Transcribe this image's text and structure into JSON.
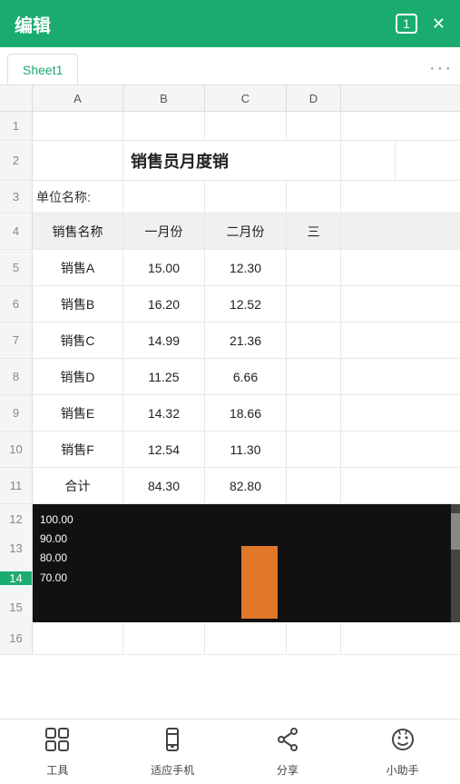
{
  "topBar": {
    "title": "编辑",
    "numLabel": "1",
    "closeIcon": "✕"
  },
  "sheetTab": {
    "label": "Sheet1",
    "moreIcon": "···"
  },
  "colHeaders": [
    "A",
    "B",
    "C",
    "D"
  ],
  "rows": [
    {
      "rowNum": "1",
      "cells": [
        "",
        "",
        "",
        "",
        ""
      ]
    },
    {
      "rowNum": "2",
      "cells": [
        "",
        "",
        "销售员月度销",
        "",
        ""
      ]
    },
    {
      "rowNum": "3",
      "cells": [
        "",
        "单位名称:",
        "",
        "",
        ""
      ]
    },
    {
      "rowNum": "4",
      "cells": [
        "",
        "销售名称",
        "一月份",
        "二月份",
        "三"
      ]
    },
    {
      "rowNum": "5",
      "cells": [
        "",
        "销售A",
        "15.00",
        "12.30",
        ""
      ]
    },
    {
      "rowNum": "6",
      "cells": [
        "",
        "销售B",
        "16.20",
        "12.52",
        ""
      ]
    },
    {
      "rowNum": "7",
      "cells": [
        "",
        "销售C",
        "14.99",
        "21.36",
        ""
      ]
    },
    {
      "rowNum": "8",
      "cells": [
        "",
        "销售D",
        "11.25",
        "6.66",
        ""
      ]
    },
    {
      "rowNum": "9",
      "cells": [
        "",
        "销售E",
        "14.32",
        "18.66",
        ""
      ]
    },
    {
      "rowNum": "10",
      "cells": [
        "",
        "销售F",
        "12.54",
        "11.30",
        ""
      ]
    },
    {
      "rowNum": "11",
      "cells": [
        "",
        "合计",
        "84.30",
        "82.80",
        ""
      ]
    }
  ],
  "activeRow": "14",
  "chart": {
    "yLabels": [
      "100.00",
      "90.00",
      "80.00",
      "70.00"
    ],
    "barHeight": 80
  },
  "bottomNav": {
    "tools": "工具",
    "adapt": "适应手机",
    "share": "分享",
    "assistant": "小助手"
  }
}
